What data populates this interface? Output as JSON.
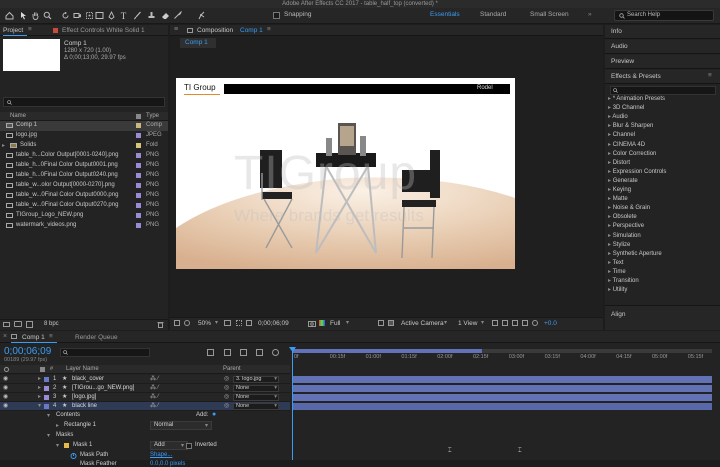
{
  "window_title": "Adobe After Effects CC 2017 - table_half_top (converted) *",
  "toolbar": {
    "snapping_label": "Snapping",
    "workspaces": [
      "Essentials",
      "Standard",
      "Small Screen"
    ],
    "search_placeholder": "Search Help"
  },
  "project": {
    "tab_project": "Project",
    "tab_effect_controls": "Effect Controls White Solid 1",
    "selected_name": "Comp 1",
    "selected_info1": "1280 x 720 (1.00)",
    "selected_info2": "Δ 0;00;13;00, 29.97 fps",
    "search_placeholder": "",
    "col_name": "Name",
    "col_type": "Type",
    "items": [
      {
        "name": "Comp 1",
        "type": "Comp",
        "color": "#c9b77e",
        "icon": "comp-icon"
      },
      {
        "name": "logo.jpg",
        "type": "JPEG",
        "color": "#9b8bd6",
        "icon": "image-icon"
      },
      {
        "name": "Solids",
        "type": "Fold",
        "color": "#d9c57a",
        "icon": "folder-icon"
      },
      {
        "name": "table_h...Color Output[0001-0240].png",
        "type": "PNG",
        "color": "#9b8bd6",
        "icon": "sequence-icon"
      },
      {
        "name": "table_h...0Final Color Output0001.png",
        "type": "PNG",
        "color": "#9b8bd6",
        "icon": "image-icon"
      },
      {
        "name": "table_h...0Final Color Output0240.png",
        "type": "PNG",
        "color": "#9b8bd6",
        "icon": "image-icon"
      },
      {
        "name": "table_w...olor Output[0000-0270].png",
        "type": "PNG",
        "color": "#9b8bd6",
        "icon": "sequence-icon"
      },
      {
        "name": "table_w...0Final Color Output0000.png",
        "type": "PNG",
        "color": "#9b8bd6",
        "icon": "image-icon"
      },
      {
        "name": "table_w...0Final Color Output0270.png",
        "type": "PNG",
        "color": "#9b8bd6",
        "icon": "image-icon"
      },
      {
        "name": "TIGroup_Logo_NEW.png",
        "type": "PNG",
        "color": "#9b8bd6",
        "icon": "image-icon"
      },
      {
        "name": "watermark_videos.png",
        "type": "PNG",
        "color": "#9b8bd6",
        "icon": "image-icon"
      }
    ],
    "bpc": "8 bpc"
  },
  "composition": {
    "tab_label": "Composition",
    "comp_name": "Comp 1",
    "subtab": "Comp 1",
    "logo_text": "TI Group",
    "banner_text": "Rodel",
    "watermark_big": "TIGroup",
    "watermark_small": "Where brands get results",
    "zoom": "50%",
    "timecode": "0;00;06;09",
    "resolution": "Full",
    "camera": "Active Camera",
    "views": "1 View",
    "exposure": "+0.0"
  },
  "right_panel": {
    "sections": [
      "Info",
      "Audio",
      "Preview",
      "Effects & Presets"
    ],
    "search_placeholder": "",
    "effects": [
      "* Animation Presets",
      "3D Channel",
      "Audio",
      "Blur & Sharpen",
      "Channel",
      "CINEMA 4D",
      "Color Correction",
      "Distort",
      "Expression Controls",
      "Generate",
      "Keying",
      "Matte",
      "Noise & Grain",
      "Obsolete",
      "Perspective",
      "Simulation",
      "Stylize",
      "Synthetic Aperture",
      "Text",
      "Time",
      "Transition",
      "Utility"
    ],
    "align_label": "Align"
  },
  "timeline": {
    "tab_comp": "Comp 1",
    "tab_render": "Render Queue",
    "timecode": "0;00;06;09",
    "frame_info": "00189 (29.97 fps)",
    "col_layer_name": "Layer Name",
    "col_parent": "Parent",
    "ruler": [
      "0f",
      "00:15f",
      "01:00f",
      "01:15f",
      "02:00f",
      "02:15f",
      "03:00f",
      "03:15f",
      "04:00f",
      "04:15f",
      "05:00f",
      "05:15f"
    ],
    "layers": [
      {
        "num": "1",
        "name": "black_cover",
        "parent": "3. logo.jpg",
        "color": "#6a78c8"
      },
      {
        "num": "2",
        "name": "[TIGrou...go_NEW.png]",
        "parent": "None",
        "color": "#9b8bd6"
      },
      {
        "num": "3",
        "name": "[logo.jpg]",
        "parent": "None",
        "color": "#9b8bd6"
      },
      {
        "num": "4",
        "name": "black line",
        "parent": "None",
        "color": "#6a78c8"
      }
    ],
    "contents_label": "Contents",
    "add_label": "Add:",
    "rectangle_label": "Rectangle 1",
    "blend_mode": "Normal",
    "masks_label": "Masks",
    "mask_label": "Mask 1",
    "mask_mode": "Add",
    "inverted_label": "Inverted",
    "mask_path_label": "Mask Path",
    "mask_path_value": "Shape...",
    "mask_feather_label": "Mask Feather",
    "mask_feather_value": "0.0,0.0 pixels"
  }
}
